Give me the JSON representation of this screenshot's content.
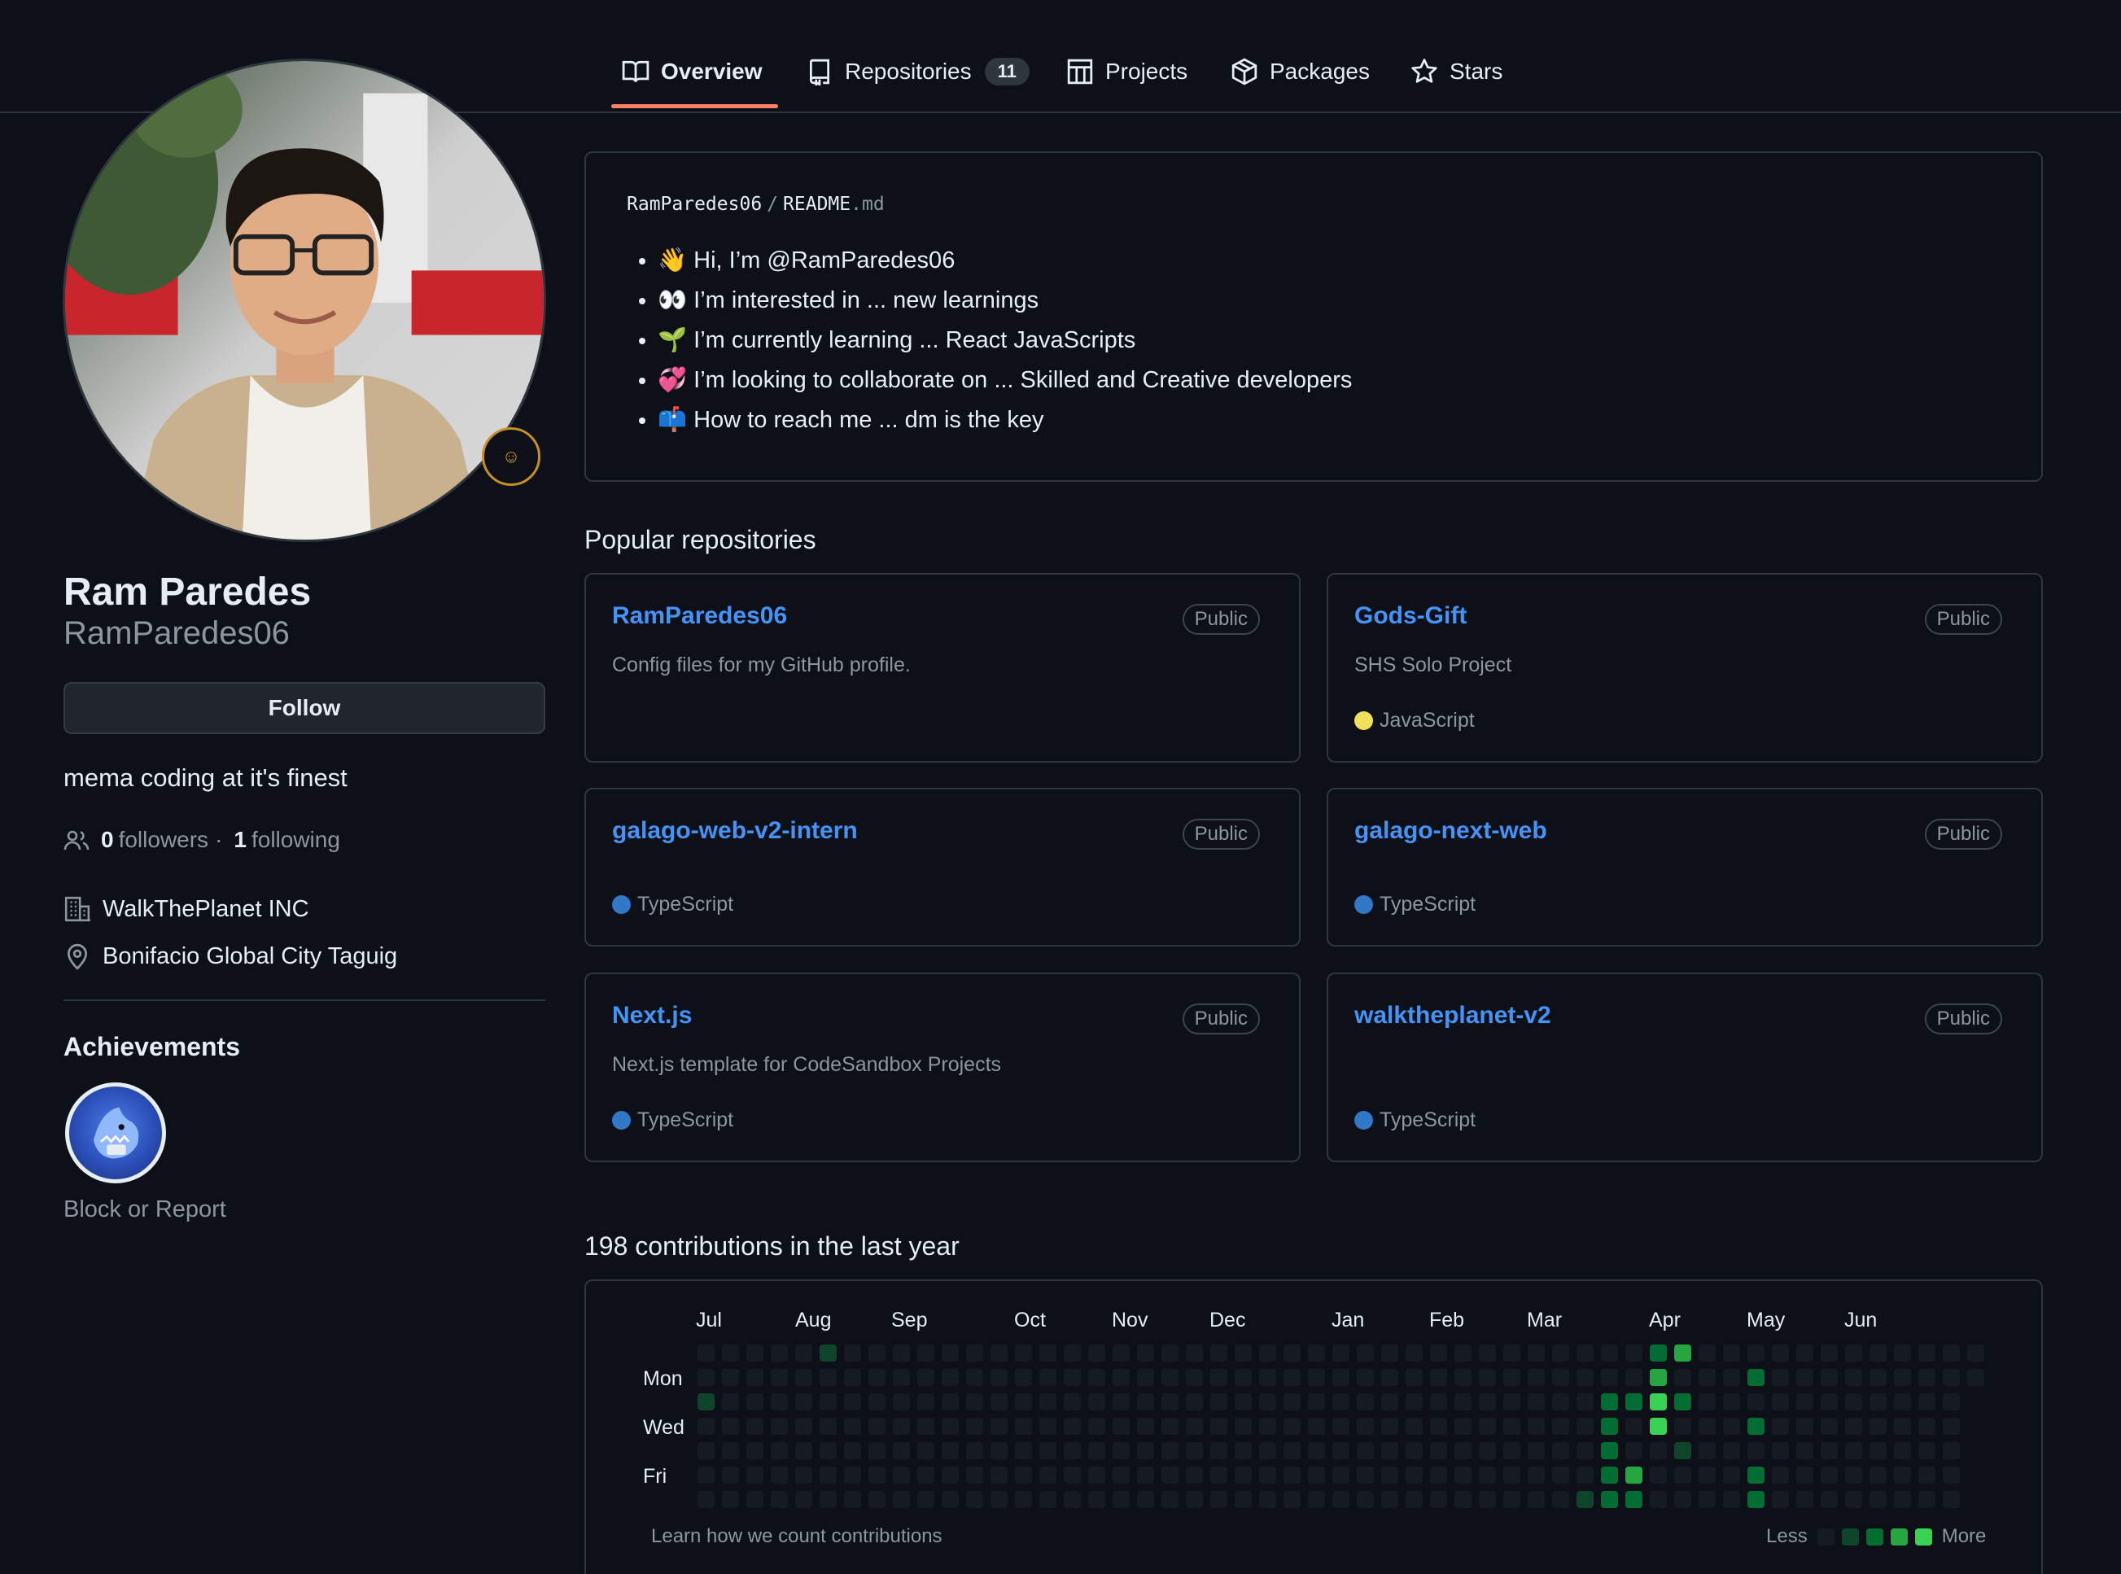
{
  "nav": {
    "tabs": [
      {
        "label": "Overview",
        "icon": "book-icon"
      },
      {
        "label": "Repositories",
        "icon": "repo-icon",
        "count": "11"
      },
      {
        "label": "Projects",
        "icon": "table-icon"
      },
      {
        "label": "Packages",
        "icon": "package-icon"
      },
      {
        "label": "Stars",
        "icon": "star-icon"
      }
    ]
  },
  "profile": {
    "name": "Ram Paredes",
    "login": "RamParedes06",
    "follow_label": "Follow",
    "bio": "mema coding at it's finest",
    "followers_count": "0",
    "followers_label": "followers",
    "separator": "·",
    "following_count": "1",
    "following_label": "following",
    "company": "WalkThePlanet INC",
    "location": "Bonifacio Global City Taguig",
    "achievements_title": "Achievements",
    "block_label": "Block or Report"
  },
  "readme": {
    "owner": "RamParedes06",
    "slash": "/",
    "file": "README",
    "ext": ".md",
    "items": [
      "👋 Hi, I’m @RamParedes06",
      "👀 I’m interested in ... new learnings",
      "🌱 I’m currently learning ... React JavaScripts",
      "💞️ I’m looking to collaborate on ... Skilled and Creative developers",
      "📫 How to reach me ... dm is the key"
    ]
  },
  "popular": {
    "title": "Popular repositories",
    "repos": [
      {
        "name": "RamParedes06",
        "visibility": "Public",
        "description": "Config files for my GitHub profile.",
        "language": ""
      },
      {
        "name": "Gods-Gift",
        "visibility": "Public",
        "description": "SHS Solo Project",
        "language": "JavaScript"
      },
      {
        "name": "galago-web-v2-intern",
        "visibility": "Public",
        "description": "",
        "language": "TypeScript"
      },
      {
        "name": "galago-next-web",
        "visibility": "Public",
        "description": "",
        "language": "TypeScript"
      },
      {
        "name": "Next.js",
        "visibility": "Public",
        "description": "Next.js template for CodeSandbox Projects",
        "language": "TypeScript"
      },
      {
        "name": "walktheplanet-v2",
        "visibility": "Public",
        "description": "",
        "language": "TypeScript"
      }
    ]
  },
  "contributions": {
    "title": "198 contributions in the last year",
    "months": [
      "Jul",
      "Aug",
      "Sep",
      "Oct",
      "Nov",
      "Dec",
      "Jan",
      "Feb",
      "Mar",
      "Apr",
      "May",
      "Jun"
    ],
    "days": [
      "Mon",
      "Wed",
      "Fri"
    ],
    "learn_label": "Learn how we count contributions",
    "less_label": "Less",
    "more_label": "More"
  },
  "colors": {
    "bg": "#0d1117",
    "border": "#30363d",
    "link": "#4493f8",
    "accent_underline": "#f78166",
    "typescript": "#3178c6",
    "javascript": "#f1e05a",
    "levels": [
      "#161b22",
      "#0e4429",
      "#006d32",
      "#26a641",
      "#39d353"
    ]
  }
}
